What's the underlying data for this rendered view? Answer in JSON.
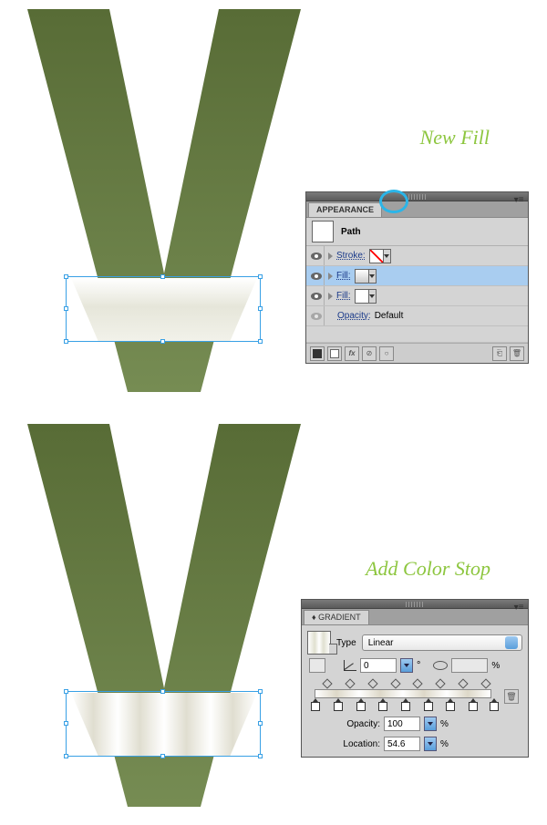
{
  "labels": {
    "new_fill": "New Fill",
    "add_color_stop": "Add Color Stop"
  },
  "appearance": {
    "title": "APPEARANCE",
    "object": "Path",
    "rows": [
      {
        "label": "Stroke:",
        "swatch": "none"
      },
      {
        "label": "Fill:",
        "swatch": "grad",
        "selected": true
      },
      {
        "label": "Fill:",
        "swatch": "white"
      }
    ],
    "opacity_label": "Opacity:",
    "opacity_value": "Default"
  },
  "gradient": {
    "title": "GRADIENT",
    "type_label": "Type",
    "type_value": "Linear",
    "angle": "0",
    "aspect_pct": "%",
    "opacity_label": "Opacity:",
    "opacity_value": "100",
    "location_label": "Location:",
    "location_value": "54.6",
    "pct": "%",
    "stops_count": 9
  }
}
